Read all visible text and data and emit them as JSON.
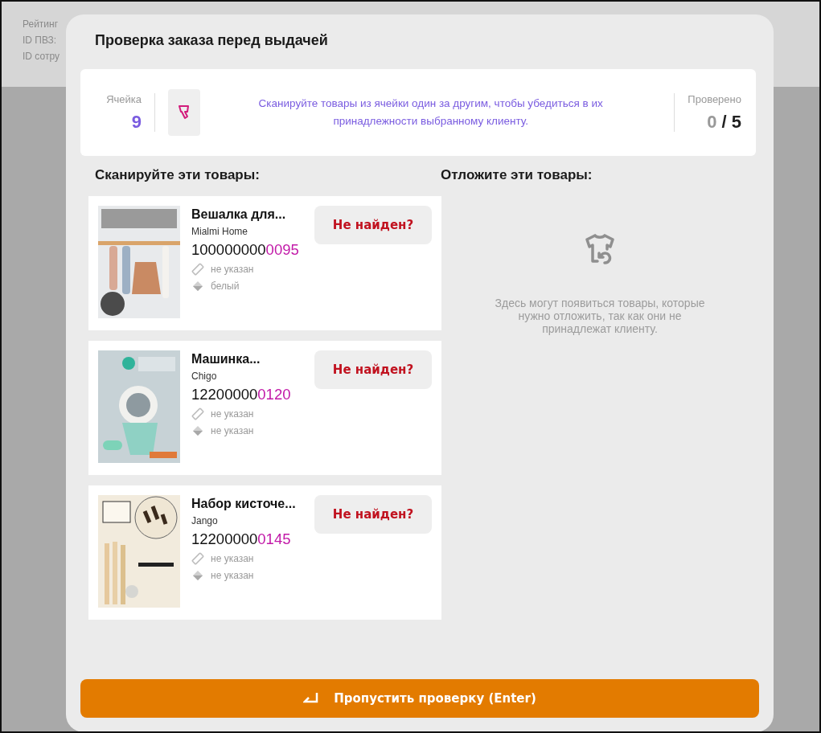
{
  "background_page": {
    "lines": [
      "Рейтинг",
      "ID ПВЗ:",
      "ID сотру"
    ]
  },
  "modal": {
    "title": "Проверка заказа перед выдачей",
    "info": {
      "cell_label": "Ячейка",
      "cell_value": "9",
      "hint": "Сканируйте товары из ячейки один за другим, чтобы убедиться в их принадлежности выбранному клиенту.",
      "checked_label": "Проверено",
      "checked_count": "0",
      "total": "/ 5"
    },
    "scan_heading": "Сканируйте эти товары:",
    "items": [
      {
        "title": "Вешалка для...",
        "brand": "Mialmi Home",
        "code_prefix": "100000000",
        "code_suffix": "0095",
        "size": "не указан",
        "color_name": "белый",
        "button": "Не найден?"
      },
      {
        "title": "Машинка...",
        "brand": "Chigo",
        "code_prefix": "12200000",
        "code_suffix": "0120",
        "size": "не указан",
        "color_name": "не указан",
        "button": "Не найден?"
      },
      {
        "title": "Набор кисточе...",
        "brand": "Jango",
        "code_prefix": "12200000",
        "code_suffix": "0145",
        "size": "не указан",
        "color_name": "не указан",
        "button": "Не найден?"
      }
    ],
    "setaside_heading": "Отложите эти товары:",
    "empty_text": "Здесь могут появиться товары, которые нужно отложить, так как они не принадлежат клиенту.",
    "skip_button": "Пропустить проверку (Enter)"
  }
}
